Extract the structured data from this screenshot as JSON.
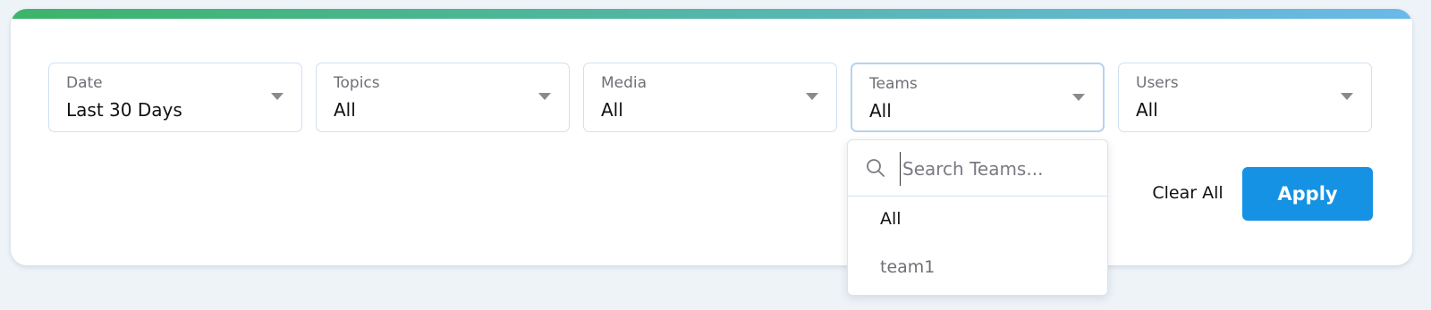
{
  "colors": {
    "accent_gradient_start": "#3cb46a",
    "accent_gradient_end": "#6bb9e8",
    "apply_button": "#1592e3"
  },
  "filters": [
    {
      "label": "Date",
      "value": "Last 30 Days"
    },
    {
      "label": "Topics",
      "value": "All"
    },
    {
      "label": "Media",
      "value": "All"
    },
    {
      "label": "Teams",
      "value": "All"
    },
    {
      "label": "Users",
      "value": "All"
    }
  ],
  "actions": {
    "clear_all_label": "Clear All",
    "apply_label": "Apply"
  },
  "teams_dropdown": {
    "search_placeholder": "Search Teams...",
    "search_icon": "search-icon",
    "options": [
      "All",
      "team1"
    ]
  }
}
